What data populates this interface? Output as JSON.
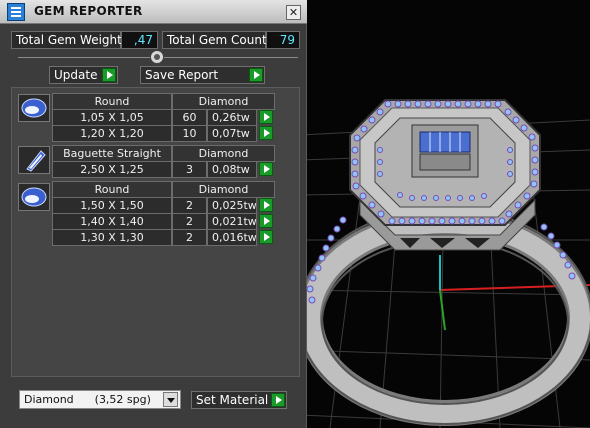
{
  "window": {
    "title": "GEM REPORTER",
    "close_glyph": "✕"
  },
  "summary": {
    "weight_label": "Total Gem Weight",
    "weight_value": ",47",
    "count_label": "Total Gem Count",
    "count_value": "79"
  },
  "actions": {
    "update_label": "Update",
    "save_label": "Save Report"
  },
  "groups": [
    {
      "icon": "round-gem-icon",
      "shape": "Round",
      "material": "Diamond",
      "rows": [
        {
          "size": "1,05 X 1,05",
          "count": "60",
          "weight": "0,26tw"
        },
        {
          "size": "1,20 X 1,20",
          "count": "10",
          "weight": "0,07tw"
        }
      ]
    },
    {
      "icon": "baguette-gem-icon",
      "shape": "Baguette Straight",
      "material": "Diamond",
      "rows": [
        {
          "size": "2,50 X 1,25",
          "count": "3",
          "weight": "0,08tw"
        }
      ]
    },
    {
      "icon": "round-gem-icon",
      "shape": "Round",
      "material": "Diamond",
      "rows": [
        {
          "size": "1,50 X 1,50",
          "count": "2",
          "weight": "0,025tw"
        },
        {
          "size": "1,40 X 1,40",
          "count": "2",
          "weight": "0,021tw"
        },
        {
          "size": "1,30 X 1,30",
          "count": "2",
          "weight": "0,016tw"
        }
      ]
    }
  ],
  "footer": {
    "material_select_value": "Diamond      (3,52 spg)",
    "set_material_label": "Set Material"
  },
  "colors": {
    "accent_value": "#5fe8ff",
    "green_button": "#1a9a28",
    "gem_blue": "#8fc4f5",
    "gem_purple": "#8a55c8",
    "metal_grey": "#bdbdbd"
  }
}
